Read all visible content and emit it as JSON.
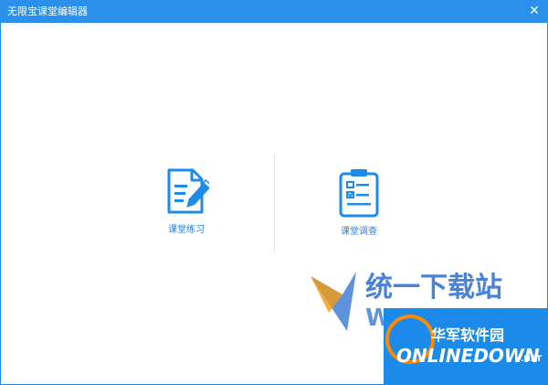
{
  "window": {
    "title": "无限宝课堂编辑器",
    "close_label": "✕"
  },
  "options": [
    {
      "label": "课堂练习",
      "icon": "document-edit-icon"
    },
    {
      "label": "课堂调查",
      "icon": "clipboard-checklist-icon"
    }
  ],
  "watermark": {
    "brand_cn": "华军软件园",
    "brand_en": "ONLINEDOWN",
    "brand_suffix": ".NET",
    "left_text_top": "统一下载站",
    "left_text_bottom": "W"
  },
  "colors": {
    "primary": "#2a90ea",
    "icon_blue": "#1f8be8",
    "label_blue": "#2d7fd8",
    "watermark_orange": "#ff8a00"
  }
}
